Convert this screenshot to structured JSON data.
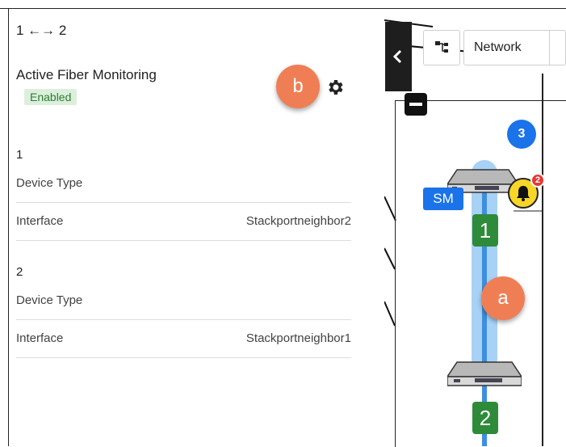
{
  "panel": {
    "title": "1 ←→ 2",
    "section_title": "Active Fiber Monitoring",
    "status": "Enabled",
    "groups": [
      {
        "number": "1",
        "rows": [
          {
            "label": "Device Type",
            "value": ""
          },
          {
            "label": "Interface",
            "value": "Stackportneighbor2"
          }
        ]
      },
      {
        "number": "2",
        "rows": [
          {
            "label": "Device Type",
            "value": ""
          },
          {
            "label": "Interface",
            "value": "Stackportneighbor1"
          }
        ]
      }
    ]
  },
  "callouts": {
    "a": "a",
    "b": "b"
  },
  "map": {
    "network_label": "Network",
    "cluster_count": "3",
    "sm_label": "SM",
    "alarm_count": "2",
    "port_labels": [
      "1",
      "2"
    ]
  },
  "icons": [
    "gear-icon",
    "chevron-left-icon",
    "topology-icon",
    "minus-icon",
    "bell-icon",
    "switch-icon"
  ],
  "colors": {
    "callout": "#f07e55",
    "enabled_bg": "#dcefdc",
    "enabled_text": "#2e7d32",
    "link": "#3d8fe0",
    "port_label": "#2e8b3a",
    "badge_blue": "#1a73e8",
    "alarm": "#f8d628"
  }
}
